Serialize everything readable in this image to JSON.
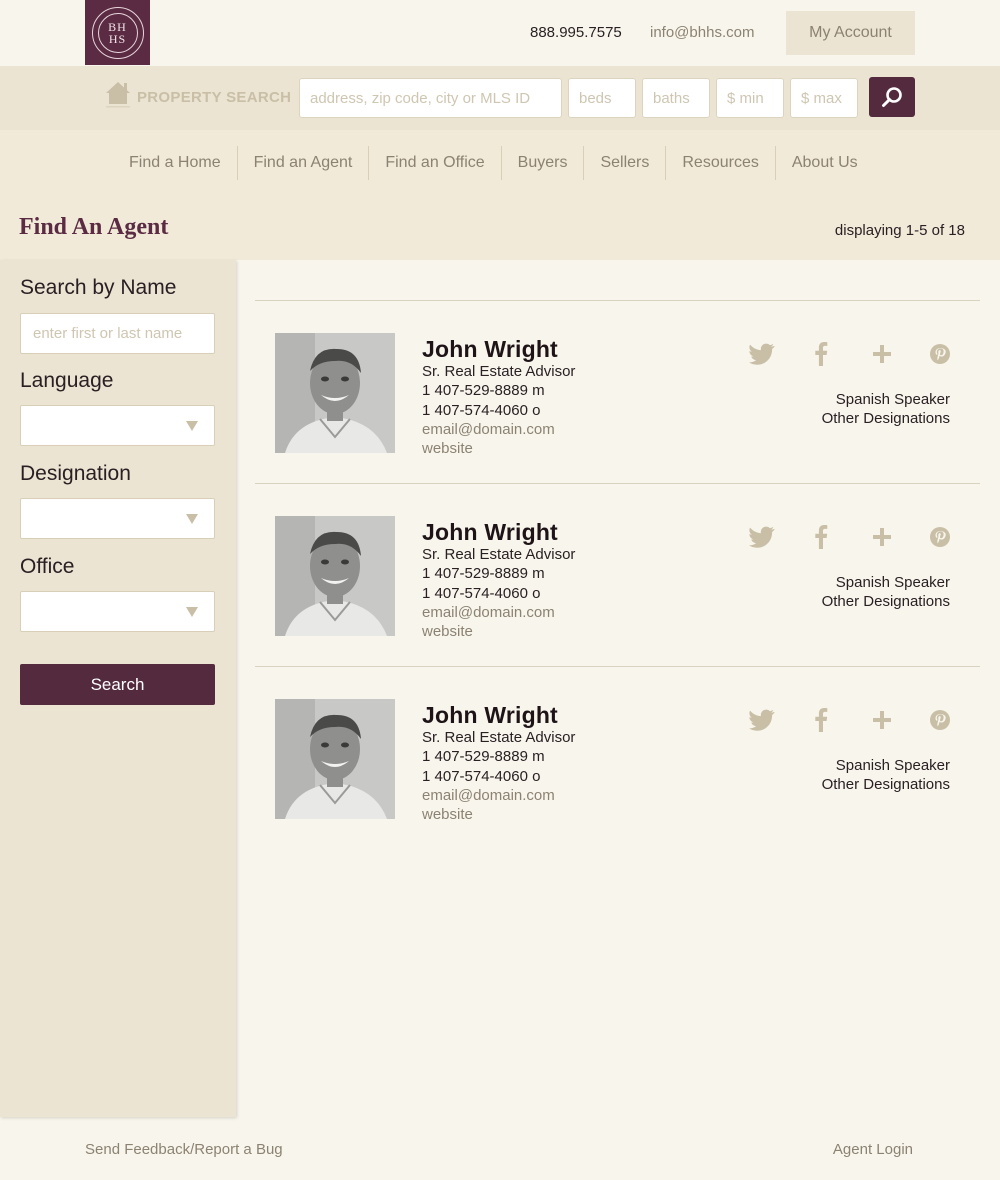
{
  "header": {
    "logo_text": "BH HS",
    "phone": "888.995.7575",
    "email": "info@bhhs.com",
    "account_label": "My Account"
  },
  "search": {
    "label": "PROPERTY SEARCH",
    "address_placeholder": "address, zip code, city or MLS ID",
    "beds_placeholder": "beds",
    "baths_placeholder": "baths",
    "min_placeholder": "$ min",
    "max_placeholder": "$ max"
  },
  "nav": {
    "items": [
      "Find a Home",
      "Find an Agent",
      "Find an Office",
      "Buyers",
      "Sellers",
      "Resources",
      "About Us"
    ]
  },
  "page": {
    "title": "Find An Agent",
    "display_count": "displaying 1-5 of 18"
  },
  "sidebar": {
    "name_label": "Search by Name",
    "name_placeholder": "enter first or last name",
    "language_label": "Language",
    "designation_label": "Designation",
    "office_label": "Office",
    "search_label": "Search"
  },
  "agents": [
    {
      "name": "John Wright",
      "title": "Sr. Real Estate Advisor",
      "mobile": "1 407-529-8889 m",
      "office": "1 407-574-4060 o",
      "email": "email@domain.com",
      "website": "website",
      "language": "Spanish Speaker",
      "designations": "Other Designations"
    },
    {
      "name": "John Wright",
      "title": "Sr. Real Estate Advisor",
      "mobile": "1 407-529-8889 m",
      "office": "1 407-574-4060 o",
      "email": "email@domain.com",
      "website": "website",
      "language": "Spanish Speaker",
      "designations": "Other Designations"
    },
    {
      "name": "John Wright",
      "title": "Sr. Real Estate Advisor",
      "mobile": "1 407-529-8889 m",
      "office": "1 407-574-4060 o",
      "email": "email@domain.com",
      "website": "website",
      "language": "Spanish Speaker",
      "designations": "Other Designations"
    }
  ],
  "social_icons": [
    "twitter-icon",
    "facebook-icon",
    "google-plus-icon",
    "pinterest-icon"
  ],
  "footer": {
    "feedback": "Send Feedback/Report a Bug",
    "agent_login": "Agent Login"
  },
  "colors": {
    "brand": "#542a3f",
    "background": "#f8f6ec",
    "panel": "#ece4d2",
    "muted_text": "#8c8272"
  }
}
